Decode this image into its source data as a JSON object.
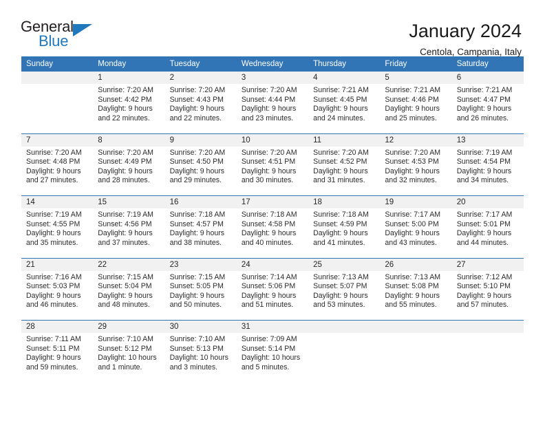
{
  "brand": {
    "name_part1": "General",
    "name_part2": "Blue",
    "triangle_icon": "blue-triangle-icon"
  },
  "header": {
    "title": "January 2024",
    "subtitle": "Centola, Campania, Italy"
  },
  "colors": {
    "header_blue": "#3275b7",
    "brand_blue": "#1f77bd",
    "daynum_strip": "#f1f1f1",
    "text": "#1a1a1a"
  },
  "calendar": {
    "weekday_headers": [
      "Sunday",
      "Monday",
      "Tuesday",
      "Wednesday",
      "Thursday",
      "Friday",
      "Saturday"
    ],
    "weeks": [
      [
        {
          "day": "",
          "lines": []
        },
        {
          "day": "1",
          "lines": [
            "Sunrise: 7:20 AM",
            "Sunset: 4:42 PM",
            "Daylight: 9 hours",
            "and 22 minutes."
          ]
        },
        {
          "day": "2",
          "lines": [
            "Sunrise: 7:20 AM",
            "Sunset: 4:43 PM",
            "Daylight: 9 hours",
            "and 22 minutes."
          ]
        },
        {
          "day": "3",
          "lines": [
            "Sunrise: 7:20 AM",
            "Sunset: 4:44 PM",
            "Daylight: 9 hours",
            "and 23 minutes."
          ]
        },
        {
          "day": "4",
          "lines": [
            "Sunrise: 7:21 AM",
            "Sunset: 4:45 PM",
            "Daylight: 9 hours",
            "and 24 minutes."
          ]
        },
        {
          "day": "5",
          "lines": [
            "Sunrise: 7:21 AM",
            "Sunset: 4:46 PM",
            "Daylight: 9 hours",
            "and 25 minutes."
          ]
        },
        {
          "day": "6",
          "lines": [
            "Sunrise: 7:21 AM",
            "Sunset: 4:47 PM",
            "Daylight: 9 hours",
            "and 26 minutes."
          ]
        }
      ],
      [
        {
          "day": "7",
          "lines": [
            "Sunrise: 7:20 AM",
            "Sunset: 4:48 PM",
            "Daylight: 9 hours",
            "and 27 minutes."
          ]
        },
        {
          "day": "8",
          "lines": [
            "Sunrise: 7:20 AM",
            "Sunset: 4:49 PM",
            "Daylight: 9 hours",
            "and 28 minutes."
          ]
        },
        {
          "day": "9",
          "lines": [
            "Sunrise: 7:20 AM",
            "Sunset: 4:50 PM",
            "Daylight: 9 hours",
            "and 29 minutes."
          ]
        },
        {
          "day": "10",
          "lines": [
            "Sunrise: 7:20 AM",
            "Sunset: 4:51 PM",
            "Daylight: 9 hours",
            "and 30 minutes."
          ]
        },
        {
          "day": "11",
          "lines": [
            "Sunrise: 7:20 AM",
            "Sunset: 4:52 PM",
            "Daylight: 9 hours",
            "and 31 minutes."
          ]
        },
        {
          "day": "12",
          "lines": [
            "Sunrise: 7:20 AM",
            "Sunset: 4:53 PM",
            "Daylight: 9 hours",
            "and 32 minutes."
          ]
        },
        {
          "day": "13",
          "lines": [
            "Sunrise: 7:19 AM",
            "Sunset: 4:54 PM",
            "Daylight: 9 hours",
            "and 34 minutes."
          ]
        }
      ],
      [
        {
          "day": "14",
          "lines": [
            "Sunrise: 7:19 AM",
            "Sunset: 4:55 PM",
            "Daylight: 9 hours",
            "and 35 minutes."
          ]
        },
        {
          "day": "15",
          "lines": [
            "Sunrise: 7:19 AM",
            "Sunset: 4:56 PM",
            "Daylight: 9 hours",
            "and 37 minutes."
          ]
        },
        {
          "day": "16",
          "lines": [
            "Sunrise: 7:18 AM",
            "Sunset: 4:57 PM",
            "Daylight: 9 hours",
            "and 38 minutes."
          ]
        },
        {
          "day": "17",
          "lines": [
            "Sunrise: 7:18 AM",
            "Sunset: 4:58 PM",
            "Daylight: 9 hours",
            "and 40 minutes."
          ]
        },
        {
          "day": "18",
          "lines": [
            "Sunrise: 7:18 AM",
            "Sunset: 4:59 PM",
            "Daylight: 9 hours",
            "and 41 minutes."
          ]
        },
        {
          "day": "19",
          "lines": [
            "Sunrise: 7:17 AM",
            "Sunset: 5:00 PM",
            "Daylight: 9 hours",
            "and 43 minutes."
          ]
        },
        {
          "day": "20",
          "lines": [
            "Sunrise: 7:17 AM",
            "Sunset: 5:01 PM",
            "Daylight: 9 hours",
            "and 44 minutes."
          ]
        }
      ],
      [
        {
          "day": "21",
          "lines": [
            "Sunrise: 7:16 AM",
            "Sunset: 5:03 PM",
            "Daylight: 9 hours",
            "and 46 minutes."
          ]
        },
        {
          "day": "22",
          "lines": [
            "Sunrise: 7:15 AM",
            "Sunset: 5:04 PM",
            "Daylight: 9 hours",
            "and 48 minutes."
          ]
        },
        {
          "day": "23",
          "lines": [
            "Sunrise: 7:15 AM",
            "Sunset: 5:05 PM",
            "Daylight: 9 hours",
            "and 50 minutes."
          ]
        },
        {
          "day": "24",
          "lines": [
            "Sunrise: 7:14 AM",
            "Sunset: 5:06 PM",
            "Daylight: 9 hours",
            "and 51 minutes."
          ]
        },
        {
          "day": "25",
          "lines": [
            "Sunrise: 7:13 AM",
            "Sunset: 5:07 PM",
            "Daylight: 9 hours",
            "and 53 minutes."
          ]
        },
        {
          "day": "26",
          "lines": [
            "Sunrise: 7:13 AM",
            "Sunset: 5:08 PM",
            "Daylight: 9 hours",
            "and 55 minutes."
          ]
        },
        {
          "day": "27",
          "lines": [
            "Sunrise: 7:12 AM",
            "Sunset: 5:10 PM",
            "Daylight: 9 hours",
            "and 57 minutes."
          ]
        }
      ],
      [
        {
          "day": "28",
          "lines": [
            "Sunrise: 7:11 AM",
            "Sunset: 5:11 PM",
            "Daylight: 9 hours",
            "and 59 minutes."
          ]
        },
        {
          "day": "29",
          "lines": [
            "Sunrise: 7:10 AM",
            "Sunset: 5:12 PM",
            "Daylight: 10 hours",
            "and 1 minute."
          ]
        },
        {
          "day": "30",
          "lines": [
            "Sunrise: 7:10 AM",
            "Sunset: 5:13 PM",
            "Daylight: 10 hours",
            "and 3 minutes."
          ]
        },
        {
          "day": "31",
          "lines": [
            "Sunrise: 7:09 AM",
            "Sunset: 5:14 PM",
            "Daylight: 10 hours",
            "and 5 minutes."
          ]
        },
        {
          "day": "",
          "lines": []
        },
        {
          "day": "",
          "lines": []
        },
        {
          "day": "",
          "lines": []
        }
      ]
    ]
  }
}
